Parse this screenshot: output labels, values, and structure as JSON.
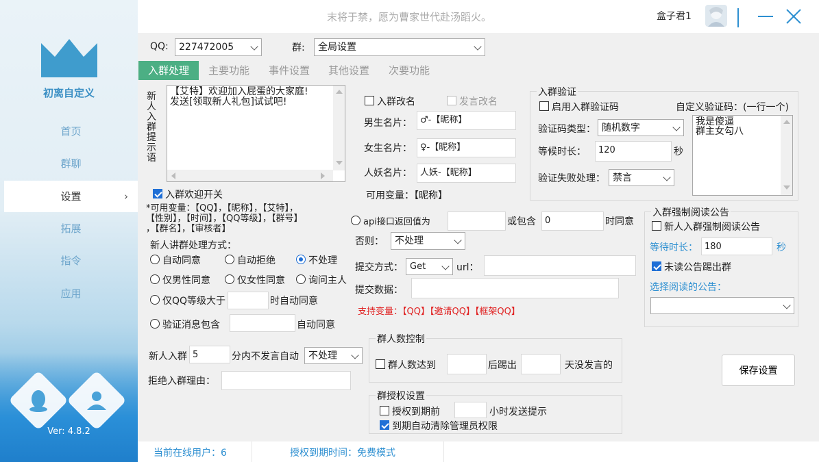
{
  "sidebar": {
    "app_name": "初离自定义",
    "nav": [
      "首页",
      "群聊",
      "设置",
      "拓展",
      "指令",
      "应用"
    ],
    "active_index": 2,
    "version": "Ver: 4.8.2"
  },
  "titlebar": {
    "motto": "末将于禁，愿为曹家世代赴汤蹈火。",
    "username": "盒子君1"
  },
  "top": {
    "qq_label": "QQ:",
    "qq_value": "227472005",
    "group_label": "群:",
    "group_value": "全局设置"
  },
  "tabs": [
    "入群处理",
    "主要功能",
    "事件设置",
    "其他设置",
    "次要功能"
  ],
  "welcome": {
    "side_label": "新人入群提示语",
    "text_line1": "【艾特】欢迎加入屁蛋的大家庭!",
    "text_line2": "发送[领取新人礼包]试试吧!",
    "toggle_label": "入群欢迎开关",
    "vars_line1": "*可用变量：【QQ】，【昵称】，【艾特】，",
    "vars_line2": "【性别】，【时间】，【QQ等级】，【群号】",
    "vars_line3": "，【群名】，【审核者】"
  },
  "join_handle": {
    "title": "新人讲群处理方式：",
    "opt_auto_agree": "自动同意",
    "opt_auto_reject": "自动拒绝",
    "opt_no_handle": "不处理",
    "opt_male": "仅男性同意",
    "opt_female": "仅女性同意",
    "opt_ask": "询问主人",
    "opt_level": "仅QQ等级大于",
    "level_suffix": "时自动同意",
    "opt_msg": "验证消息包含",
    "msg_suffix": "自动同意"
  },
  "silent": {
    "label_prefix": "新人入群",
    "value": "5",
    "label_suffix": "分内不发言自动",
    "action": "不处理"
  },
  "reject_reason_label": "拒绝入群理由：",
  "rename": {
    "join_rename": "入群改名",
    "speak_rename": "发言改名",
    "male_label": "男生名片：",
    "male_value": "♂-【昵称】",
    "female_label": "女生名片：",
    "female_value": "♀-【昵称】",
    "other_label": "人妖名片：",
    "other_value": "人妖-【昵称】",
    "vars": "可用变量：【昵称】"
  },
  "api": {
    "label": "api接口返回值为",
    "or_contains": "或包含",
    "contains_value": "0",
    "agree_suffix": "时同意",
    "else_label": "否则：",
    "else_value": "不处理",
    "method_label": "提交方式：",
    "method_value": "Get",
    "url_label": "url：",
    "data_label": "提交数据：",
    "support_vars": "支持变量：【QQ】【邀请QQ】【框架QQ】"
  },
  "member_ctrl": {
    "title": "群人数控制",
    "cb_label": "群人数达到",
    "kick_label": "后踢出",
    "days_label": "天没发言的"
  },
  "auth": {
    "title": "群授权设置",
    "expire_label": "授权到期前",
    "hours_label": "小时发送提示",
    "clear_label": "到期自动清除管理员权限"
  },
  "verify": {
    "title": "入群验证",
    "enable_label": "启用入群验证码",
    "custom_label": "自定义验证码：(一行一个)",
    "custom_line1": "我是傻逼",
    "custom_line2": "群主女勾八",
    "type_label": "验证码类型：",
    "type_value": "随机数字",
    "wait_label": "等候时长：",
    "wait_value": "120",
    "wait_unit": "秒",
    "fail_label": "验证失败处理：",
    "fail_value": "禁言"
  },
  "read_notice": {
    "title": "入群强制阅读公告",
    "enable_label": "新人入群强制阅读公告",
    "wait_label": "等待时长：",
    "wait_value": "180",
    "wait_unit": "秒",
    "kick_label": "未读公告踢出群",
    "choose_label": "选择阅读的公告："
  },
  "save_button": "保存设置",
  "status": {
    "online": "当前在线用户：6",
    "expire": "授权到期时间：免费模式"
  },
  "colors": {
    "accent": "#2d8fd1",
    "tab_active": "#4caf84",
    "link_blue": "#2d8fd1",
    "red": "#e02020"
  }
}
